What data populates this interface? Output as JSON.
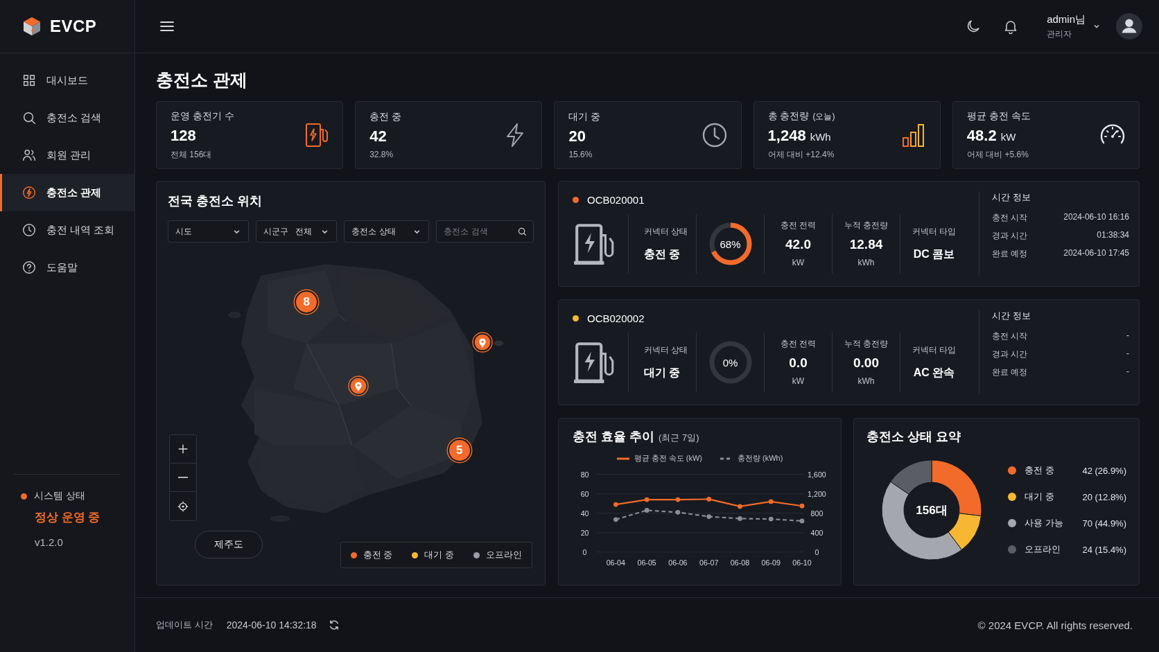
{
  "brand": {
    "name": "EVCP"
  },
  "user": {
    "name": "admin님",
    "role": "관리자"
  },
  "sidebar": {
    "items": [
      {
        "label": "대시보드",
        "selected": false
      },
      {
        "label": "충전소 검색",
        "selected": false
      },
      {
        "label": "회원 관리",
        "selected": false
      },
      {
        "label": "충전소 관제",
        "selected": true
      },
      {
        "label": "충전 내역 조회",
        "selected": false
      },
      {
        "label": "도움말",
        "selected": false
      }
    ],
    "system_status": {
      "label": "시스템 상태",
      "value": "정상 운영 중",
      "color": "#f26b2a"
    },
    "version": "v1.2.0"
  },
  "page_title": "충전소 관제",
  "stats": [
    {
      "kind": "charger",
      "label": "운영 충전기 수",
      "value": "128",
      "sub": "전체 156대"
    },
    {
      "kind": "bolt",
      "label": "충전 중",
      "value": "42",
      "sub": "32.8%"
    },
    {
      "kind": "clock",
      "label": "대기 중",
      "value": "20",
      "sub": "15.6%"
    },
    {
      "kind": "bars",
      "label": "총 충전량",
      "label_note": "(오늘)",
      "value": "1,248",
      "unit": "kWh",
      "sub": "어제 대비 +12.4%"
    },
    {
      "kind": "gauge",
      "label": "평균 충전 속도",
      "value": "48.2",
      "unit": "kW",
      "sub": "어제 대비 +5.6%"
    }
  ],
  "map": {
    "title": "전국 충전소 위치",
    "filters": [
      {
        "kind": "select",
        "label": "시도"
      },
      {
        "kind": "select",
        "label": "시군구",
        "value": "전체"
      },
      {
        "kind": "select",
        "label": "충전소 상태"
      },
      {
        "kind": "search",
        "placeholder": "충전소 검색"
      }
    ],
    "markers": [
      {
        "kind": "cluster",
        "count": "8"
      },
      {
        "kind": "pin"
      },
      {
        "kind": "pin"
      },
      {
        "kind": "cluster",
        "count": "5"
      }
    ],
    "region_button": "제주도",
    "legend": [
      {
        "label": "충전 중",
        "color": "#f26b2a"
      },
      {
        "label": "대기 중",
        "color": "#f7b733"
      },
      {
        "label": "오프라인",
        "color": "#9a9da4"
      }
    ]
  },
  "chargers": [
    {
      "id": "OCB020001",
      "color": "#f26b2a",
      "status_label": "커넥터 상태",
      "status": "충전 중",
      "level": 0.68,
      "percent": "68%",
      "power_label": "충전 전력",
      "power": "42.0",
      "power_unit": "kW",
      "energy_label": "누적 충전량",
      "energy": "12.84",
      "energy_unit": "kWh",
      "type_label": "커넥터 타입",
      "type": "DC 콤보",
      "time_title": "시간 정보",
      "times": [
        {
          "label": "충전 시작",
          "value": "2024-06-10 16:16"
        },
        {
          "label": "경과 시간",
          "value": "01:38:34"
        },
        {
          "label": "완료 예정",
          "value": "2024-06-10 17:45"
        }
      ]
    },
    {
      "id": "OCB020002",
      "color": "#f7b733",
      "status_label": "커넥터 상태",
      "status": "대기 중",
      "level": 0,
      "percent": "0%",
      "power_label": "충전 전력",
      "power": "0.0",
      "power_unit": "kW",
      "energy_label": "누적 충전량",
      "energy": "0.00",
      "energy_unit": "kWh",
      "type_label": "커넥터 타입",
      "type": "AC 완속",
      "time_title": "시간 정보",
      "times": [
        {
          "label": "충전 시작",
          "value": "-"
        },
        {
          "label": "경과 시간",
          "value": "-"
        },
        {
          "label": "완료 예정",
          "value": "-"
        }
      ]
    }
  ],
  "efficiency": {
    "title": "충전 효율 추이",
    "note": "(최근 7일)",
    "chart_data": {
      "type": "line",
      "categories": [
        "06-04",
        "06-05",
        "06-06",
        "06-07",
        "06-08",
        "06-09",
        "06-10"
      ],
      "series": [
        {
          "name": "평균 충전 속도 (kW)",
          "color": "#f26b2a",
          "values": [
            49,
            54,
            54,
            54.5,
            47,
            52,
            47.5
          ],
          "marker": true,
          "line_style": "solid"
        },
        {
          "name": "충전량 (kWh)",
          "color": "#8a8d94",
          "values": [
            670,
            860,
            820,
            730,
            690,
            680,
            640
          ],
          "marker": true,
          "line_style": "dashed",
          "axis": "y2"
        }
      ],
      "grid": true,
      "ylim": [
        0,
        80
      ],
      "yticks": [
        0,
        20,
        40,
        60,
        80
      ],
      "y2lim": [
        0,
        1600
      ],
      "y2ticks": [
        {
          "value": 0,
          "label": "0"
        },
        {
          "value": 400,
          "label": "400"
        },
        {
          "value": 800,
          "label": "800"
        },
        {
          "value": 1200,
          "label": "1,200"
        },
        {
          "value": 1600,
          "label": "1,600"
        }
      ]
    }
  },
  "summary": {
    "title": "충전소 상태 요약",
    "center_label": "156대",
    "chart_data": {
      "type": "donut",
      "categories": [
        "충전 중",
        "대기 중",
        "사용 가능",
        "오프라인"
      ],
      "values": [
        26.9,
        12.8,
        44.9,
        15.4
      ]
    },
    "legend": [
      {
        "value": "42 (26.9%)",
        "color": "#f26b2a"
      },
      {
        "value": "20 (12.8%)",
        "color": "#f7b733"
      },
      {
        "value": "70 (44.9%)",
        "color": "#a4a7ae"
      },
      {
        "value": "24 (15.4%)",
        "color": "#5a5d64"
      }
    ]
  },
  "footer": {
    "update_label": "업데이트 시간",
    "update_time": "2024-06-10 14:32:18",
    "copyright": "© 2024 EVCP. All rights reserved."
  }
}
